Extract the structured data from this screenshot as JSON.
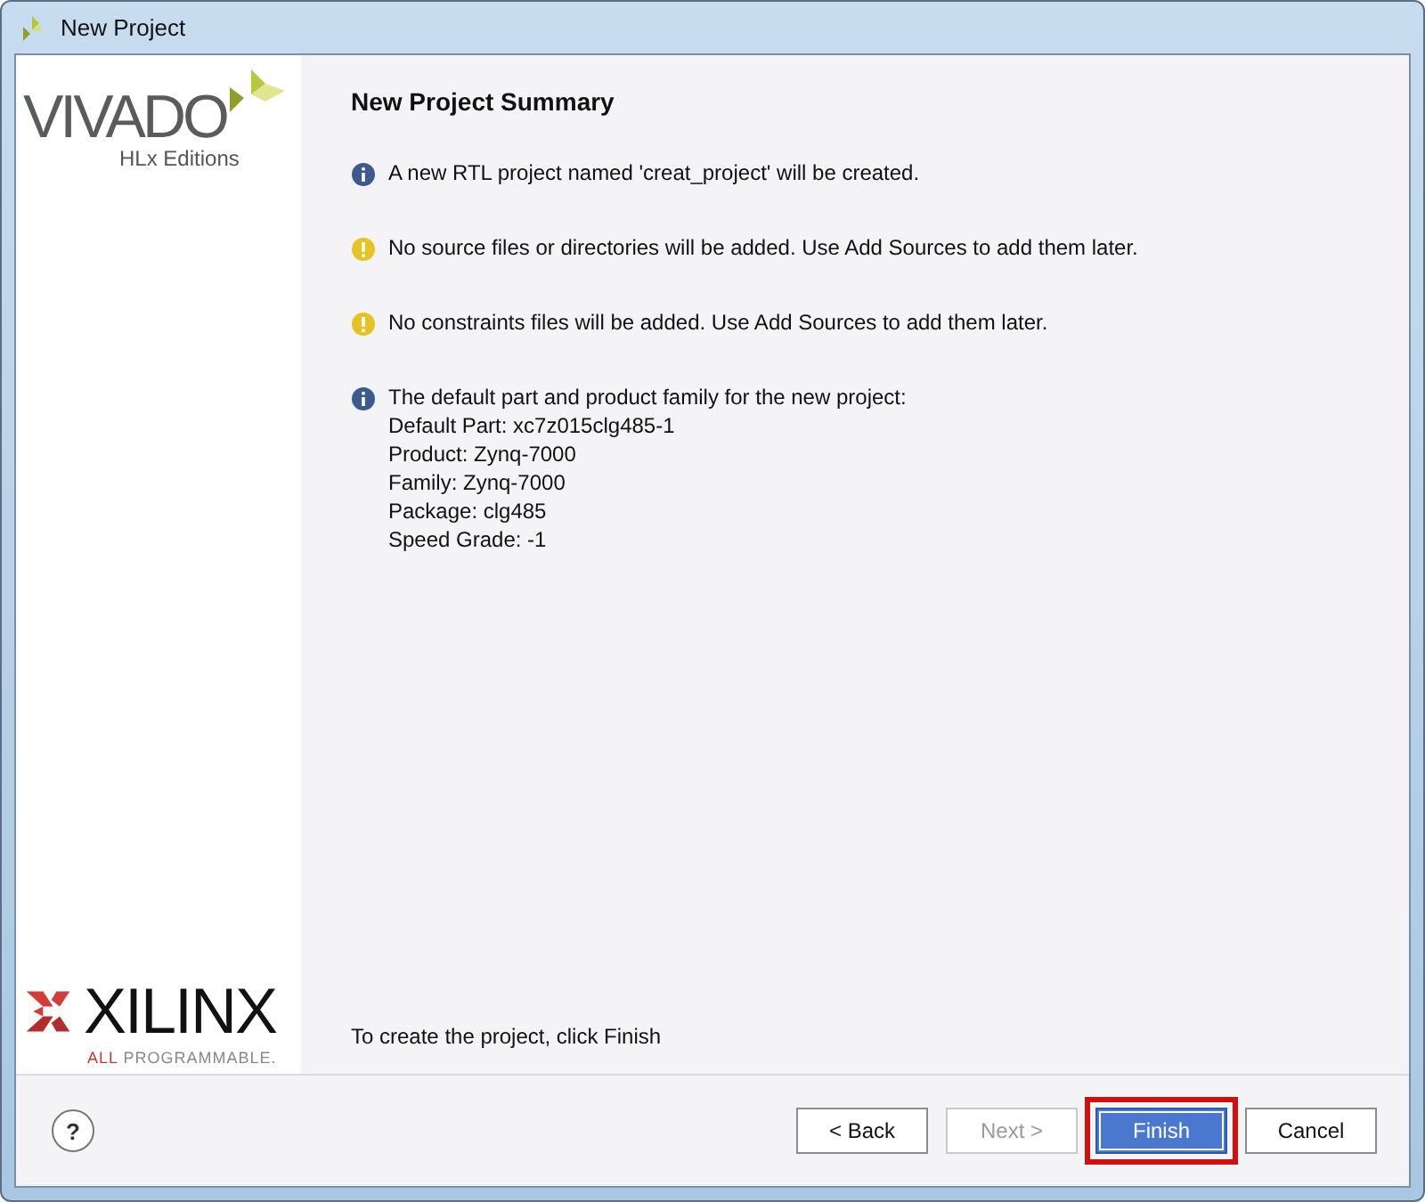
{
  "window": {
    "title": "New Project"
  },
  "sidebar": {
    "product": "VIVADO",
    "edition": "HLx Editions",
    "vendor": "XILINX",
    "tagline_accent": "ALL",
    "tagline": "PROGRAMMABLE."
  },
  "page": {
    "heading": "New Project Summary",
    "messages": [
      {
        "kind": "info",
        "lines": [
          "A new RTL project named 'creat_project' will be created."
        ]
      },
      {
        "kind": "warning",
        "lines": [
          "No source files or directories will be added. Use Add Sources to add them later."
        ]
      },
      {
        "kind": "warning",
        "lines": [
          "No constraints files will be added. Use Add Sources to add them later."
        ]
      },
      {
        "kind": "info",
        "lines": [
          "The default part and product family for the new project:",
          "Default Part: xc7z015clg485-1",
          "Product: Zynq-7000",
          "Family: Zynq-7000",
          "Package: clg485",
          "Speed Grade: -1"
        ]
      }
    ],
    "footer": "To create the project, click Finish"
  },
  "help": {
    "label": "?"
  },
  "buttons": [
    {
      "label": "< Back",
      "disabled": false,
      "default": false,
      "highlighted": false
    },
    {
      "label": "Next >",
      "disabled": true,
      "default": false,
      "highlighted": false
    },
    {
      "label": "Finish",
      "disabled": false,
      "default": true,
      "highlighted": true
    },
    {
      "label": "Cancel",
      "disabled": false,
      "default": false,
      "highlighted": false
    }
  ]
}
